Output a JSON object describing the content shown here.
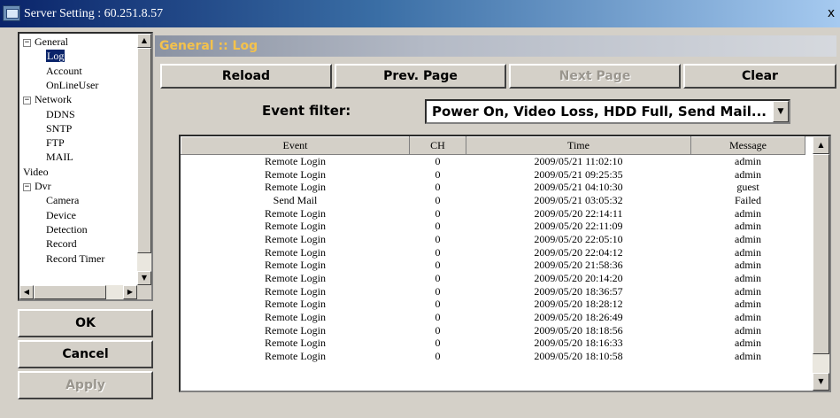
{
  "window": {
    "title": "Server Setting : 60.251.8.57",
    "close_glyph": "x"
  },
  "tree": {
    "items": [
      {
        "label": "General",
        "level": 0,
        "expander": "−"
      },
      {
        "label": "Log",
        "level": 1,
        "selected": true
      },
      {
        "label": "Account",
        "level": 1
      },
      {
        "label": "OnLineUser",
        "level": 1
      },
      {
        "label": "Network",
        "level": 0,
        "expander": "−"
      },
      {
        "label": "DDNS",
        "level": 1
      },
      {
        "label": "SNTP",
        "level": 1
      },
      {
        "label": "FTP",
        "level": 1
      },
      {
        "label": "MAIL",
        "level": 1
      },
      {
        "label": "Video",
        "level": 0
      },
      {
        "label": "Dvr",
        "level": 0,
        "expander": "−"
      },
      {
        "label": "Camera",
        "level": 1
      },
      {
        "label": "Device",
        "level": 1
      },
      {
        "label": "Detection",
        "level": 1
      },
      {
        "label": "Record",
        "level": 1
      },
      {
        "label": "Record Timer",
        "level": 1
      }
    ]
  },
  "actions": {
    "ok": "OK",
    "cancel": "Cancel",
    "apply": "Apply"
  },
  "header": {
    "title": "General :: Log"
  },
  "toolbar": {
    "reload": "Reload",
    "prev": "Prev. Page",
    "next": "Next Page",
    "clear": "Clear"
  },
  "filter": {
    "label": "Event filter:",
    "value": "Power On, Video Loss, HDD Full, Send Mail..."
  },
  "log": {
    "columns": [
      "Event",
      "CH",
      "Time",
      "Message"
    ],
    "rows": [
      [
        "Remote Login",
        "0",
        "2009/05/21 11:02:10",
        "admin"
      ],
      [
        "Remote Login",
        "0",
        "2009/05/21 09:25:35",
        "admin"
      ],
      [
        "Remote Login",
        "0",
        "2009/05/21 04:10:30",
        "guest"
      ],
      [
        "Send Mail",
        "0",
        "2009/05/21 03:05:32",
        "Failed"
      ],
      [
        "Remote Login",
        "0",
        "2009/05/20 22:14:11",
        "admin"
      ],
      [
        "Remote Login",
        "0",
        "2009/05/20 22:11:09",
        "admin"
      ],
      [
        "Remote Login",
        "0",
        "2009/05/20 22:05:10",
        "admin"
      ],
      [
        "Remote Login",
        "0",
        "2009/05/20 22:04:12",
        "admin"
      ],
      [
        "Remote Login",
        "0",
        "2009/05/20 21:58:36",
        "admin"
      ],
      [
        "Remote Login",
        "0",
        "2009/05/20 20:14:20",
        "admin"
      ],
      [
        "Remote Login",
        "0",
        "2009/05/20 18:36:57",
        "admin"
      ],
      [
        "Remote Login",
        "0",
        "2009/05/20 18:28:12",
        "admin"
      ],
      [
        "Remote Login",
        "0",
        "2009/05/20 18:26:49",
        "admin"
      ],
      [
        "Remote Login",
        "0",
        "2009/05/20 18:18:56",
        "admin"
      ],
      [
        "Remote Login",
        "0",
        "2009/05/20 18:16:33",
        "admin"
      ],
      [
        "Remote Login",
        "0",
        "2009/05/20 18:10:58",
        "admin"
      ]
    ]
  },
  "icons": {
    "window": "app-window-icon",
    "close": "close-icon",
    "dropdown": "chevron-down-icon"
  }
}
